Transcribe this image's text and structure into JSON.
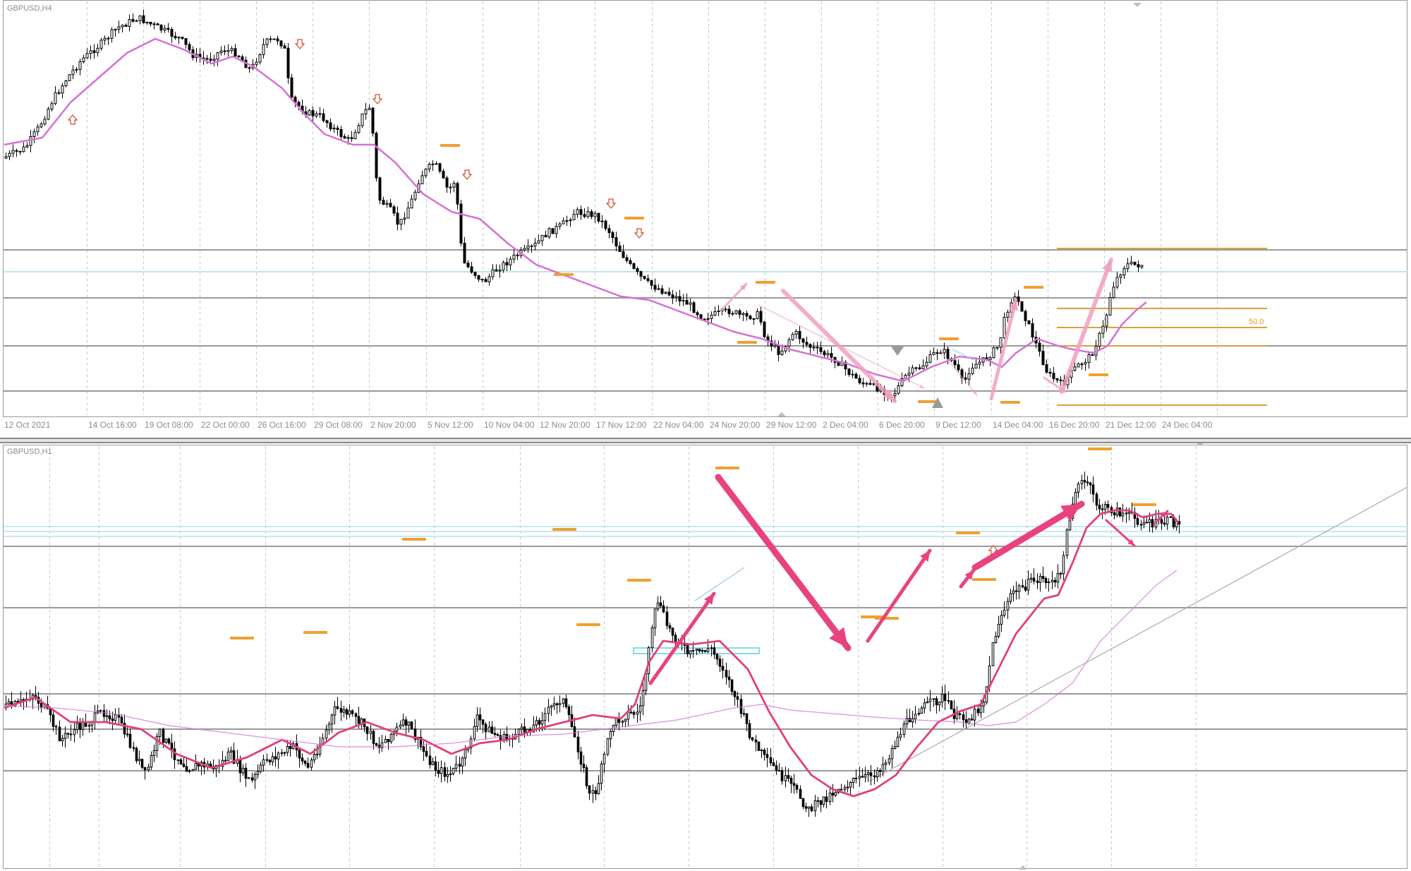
{
  "top_chart": {
    "symbol_label": "GBPUSD,H4",
    "fibo_level_label": "50.0",
    "time_axis_labels": [
      "12 Oct 2021",
      "14 Oct 16:00",
      "19 Oct 08:00",
      "22 Oct 00:00",
      "26 Oct 16:00",
      "29 Oct 08:00",
      "2 Nov 20:00",
      "5 Nov 12:00",
      "10 Nov 04:00",
      "12 Nov 20:00",
      "17 Nov 12:00",
      "22 Nov 04:00",
      "24 Nov 20:00",
      "29 Nov 12:00",
      "2 Dec 04:00",
      "6 Dec 20:00",
      "9 Dec 12:00",
      "14 Dec 04:00",
      "16 Dec 20:00",
      "21 Dec 12:00",
      "24 Dec 04:00"
    ]
  },
  "bottom_chart": {
    "symbol_label": "GBPUSD,H1"
  },
  "colors": {
    "moving_average": "#d670d6",
    "ma_fast_bottom": "#e0407a",
    "level_line": "#9a9a9a",
    "level_cyan": "#a9dceb",
    "orange_marker": "#f0a030",
    "fibo": "#d9a040",
    "pink_arrow": "#f0a0c0",
    "magenta_arrow": "#e8437e",
    "fractal_red": "#d24a2a",
    "grid": "#c8c8c8"
  }
}
